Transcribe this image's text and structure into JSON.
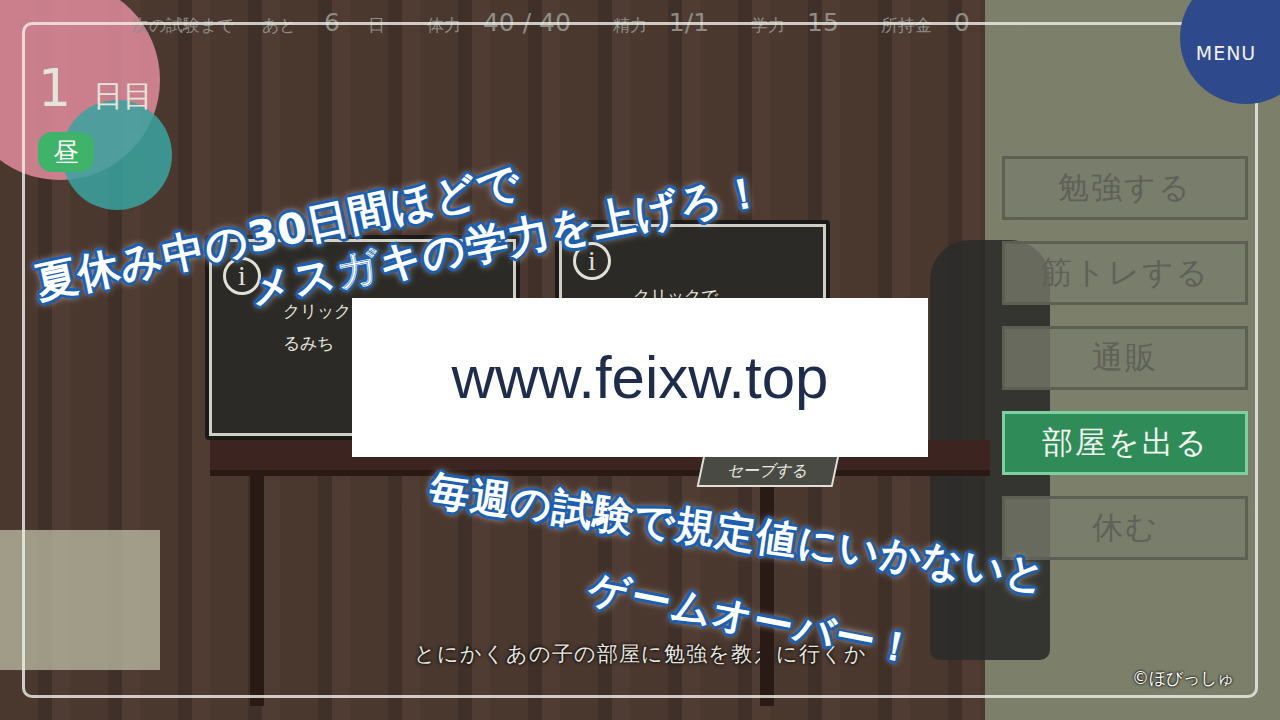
{
  "hud": {
    "exam_label": "次の試験まで",
    "exam_prefix": "あと",
    "exam_days": "6",
    "exam_suffix": "日",
    "stats": [
      {
        "label": "体力",
        "value": "40 / 40"
      },
      {
        "label": "精力",
        "value": "1/1"
      },
      {
        "label": "学力",
        "value": "15"
      },
      {
        "label": "所持金",
        "value": "0"
      }
    ]
  },
  "day": {
    "number": "1",
    "suffix": "日目",
    "time": "昼"
  },
  "menu_button": "MENU",
  "actions": [
    {
      "label": "勉強する",
      "selected": false
    },
    {
      "label": "筋トレする",
      "selected": false
    },
    {
      "label": "通販",
      "selected": false
    },
    {
      "label": "部屋を出る",
      "selected": true
    },
    {
      "label": "休む",
      "selected": false
    }
  ],
  "monitors": [
    {
      "icon": "i",
      "lines": [
        "クリックで",
        "るみち"
      ]
    },
    {
      "icon": "i",
      "lines": [
        "クリックで"
      ]
    }
  ],
  "save_button": "セーブする",
  "caption": "とにかくあの子の部屋に勉強を教えに行くか",
  "credit": "©ほびっしゅ",
  "promo": [
    "夏休み中の30日間ほどで",
    "メスガキの学力を上げろ！",
    "毎週の試験で規定値にいかないと",
    "ゲームオーバー！"
  ],
  "watermark": "www.feixw.top"
}
